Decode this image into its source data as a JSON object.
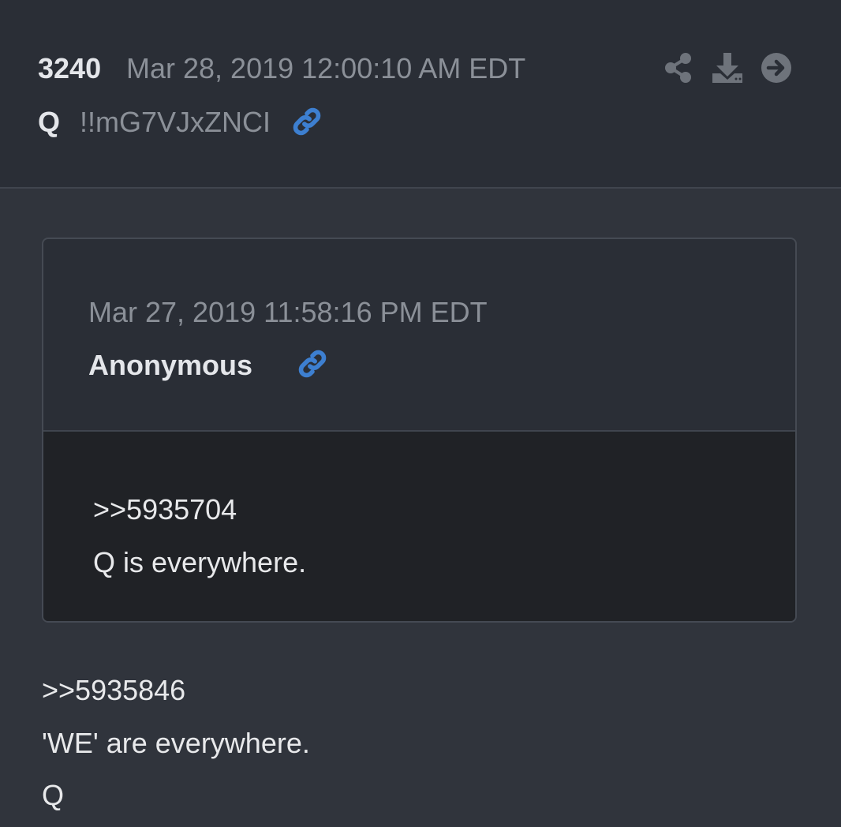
{
  "post": {
    "number": "3240",
    "date": "Mar 28, 2019 12:00:10 AM EDT",
    "author": "Q",
    "tripcode": "!!mG7VJxZNCI",
    "link_icon": "link-icon",
    "actions": [
      "share-icon",
      "download-icon",
      "arrow-circle-right-icon"
    ]
  },
  "quoted": {
    "date": "Mar 27, 2019 11:58:16 PM EDT",
    "author": "Anonymous",
    "lines": [
      ">>5935704",
      "Q is everywhere."
    ]
  },
  "body": {
    "lines": [
      ">>5935846",
      "'WE' are everywhere.",
      "Q"
    ]
  },
  "colors": {
    "background": "#30343c",
    "header_bg": "#2a2e36",
    "quote_body_bg": "#202226",
    "link_accent": "#3d7fd0",
    "muted_text": "#8b9098",
    "text": "#e8e9eb"
  }
}
